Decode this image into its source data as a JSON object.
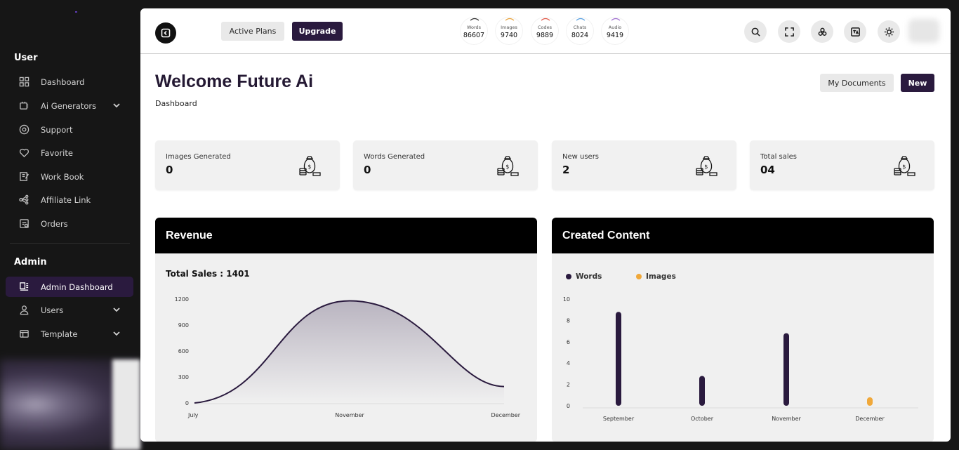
{
  "sidebar": {
    "user_section": "User",
    "admin_section": "Admin",
    "user_items": [
      {
        "label": "Dashboard",
        "icon": "grid-icon"
      },
      {
        "label": "Ai Generators",
        "icon": "ai-generator-icon",
        "has_chevron": true
      },
      {
        "label": "Support",
        "icon": "support-icon"
      },
      {
        "label": "Favorite",
        "icon": "heart-icon"
      },
      {
        "label": "Work Book",
        "icon": "workbook-icon"
      },
      {
        "label": "Affiliate Link",
        "icon": "share-icon"
      },
      {
        "label": "Orders",
        "icon": "orders-icon"
      }
    ],
    "admin_items": [
      {
        "label": "Admin Dashboard",
        "icon": "admin-dashboard-icon",
        "active": true
      },
      {
        "label": "Users",
        "icon": "user-icon",
        "has_chevron": true
      },
      {
        "label": "Template",
        "icon": "template-icon",
        "has_chevron": true
      }
    ]
  },
  "topbar": {
    "active_plans": "Active Plans",
    "upgrade": "Upgrade",
    "stats": [
      {
        "label": "Words",
        "value": "86607",
        "color": "#333333"
      },
      {
        "label": "Images",
        "value": "9740",
        "color": "#e8a33d"
      },
      {
        "label": "Codes",
        "value": "9889",
        "color": "#e05a4a"
      },
      {
        "label": "Chats",
        "value": "8024",
        "color": "#5aa0e0"
      },
      {
        "label": "Audio",
        "value": "9419",
        "color": "#a070d0"
      }
    ],
    "tools": [
      "search-icon",
      "fullscreen-icon",
      "apps-icon",
      "translate-icon",
      "sun-icon"
    ]
  },
  "header": {
    "title": "Welcome Future Ai",
    "breadcrumb": "Dashboard",
    "my_documents": "My Documents",
    "new": "New"
  },
  "cards": [
    {
      "label": "Images Generated",
      "value": "0"
    },
    {
      "label": "Words Generated",
      "value": "0"
    },
    {
      "label": "New users",
      "value": "2"
    },
    {
      "label": "Total sales",
      "value": "04"
    }
  ],
  "revenue": {
    "title": "Revenue",
    "subtitle": "Total Sales : 1401"
  },
  "content": {
    "title": "Created Content"
  },
  "colors": {
    "accent": "#2a1a3e",
    "series_words": "#2a1a3e",
    "series_images": "#f0a83a"
  },
  "chart_data": [
    {
      "type": "area",
      "title": "Revenue",
      "x": [
        "July",
        "November",
        "December"
      ],
      "y_ticks": [
        0,
        300,
        600,
        900,
        1200
      ],
      "ylim": [
        0,
        1200
      ],
      "series": [
        {
          "values": [
            0,
            1180,
            190
          ]
        }
      ],
      "grid": false
    },
    {
      "type": "bar",
      "title": "Created Content",
      "categories": [
        "September",
        "October",
        "November",
        "December"
      ],
      "y_ticks": [
        0,
        2,
        4,
        6,
        8,
        10
      ],
      "ylim": [
        0,
        10
      ],
      "legend": "top-left",
      "series": [
        {
          "name": "Words",
          "values": [
            8.8,
            2.8,
            6.8,
            0
          ]
        },
        {
          "name": "Images",
          "values": [
            0,
            0,
            0,
            0.8
          ]
        }
      ]
    }
  ]
}
